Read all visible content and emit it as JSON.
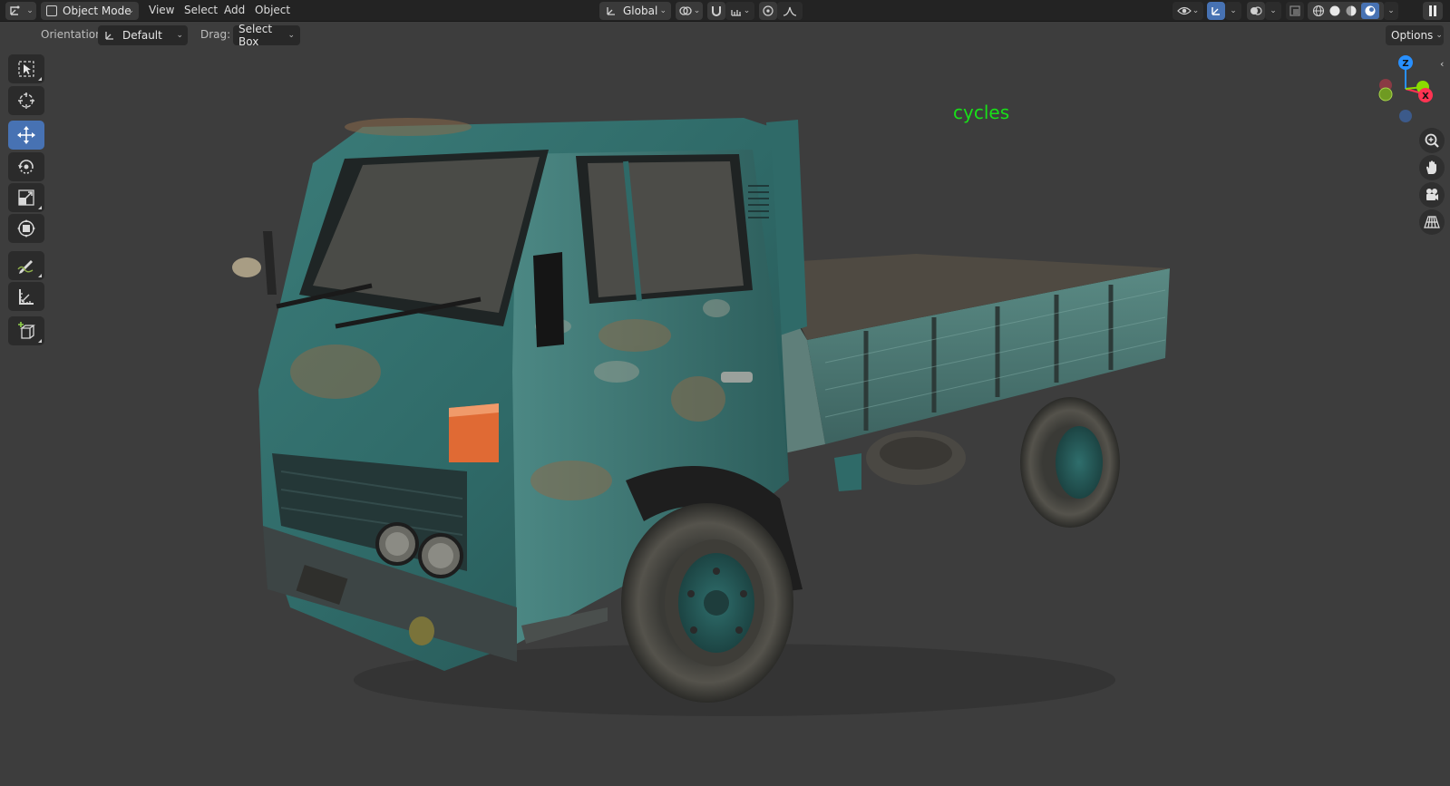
{
  "header": {
    "editor_type_icon": "3d-viewport-icon",
    "mode": "Object Mode",
    "menus": [
      "View",
      "Select",
      "Add",
      "Object"
    ],
    "transform_orientation": "Global",
    "icons": {
      "pivot": "pivot-icon",
      "snap": "magnet-icon",
      "snap_target": "snap-increment-icon",
      "proportional": "proportional-edit-icon",
      "falloff": "falloff-curve-icon",
      "visibility": "eye-icon",
      "gizmo": "gizmo-icon",
      "overlay": "overlay-icon",
      "xray": "xray-icon",
      "shading_wire": "wireframe-icon",
      "shading_solid": "solid-icon",
      "shading_material": "material-icon",
      "shading_rendered": "rendered-icon"
    }
  },
  "tool_settings": {
    "orientation_label": "Orientation:",
    "orientation_value": "Default",
    "drag_label": "Drag:",
    "drag_value": "Select Box",
    "options_label": "Options"
  },
  "tools": [
    {
      "name": "select-box-tool",
      "active": false
    },
    {
      "name": "cursor-tool",
      "active": false
    },
    {
      "name": "move-tool",
      "active": true
    },
    {
      "name": "rotate-tool",
      "active": false
    },
    {
      "name": "scale-tool",
      "active": false
    },
    {
      "name": "transform-tool",
      "active": false
    },
    {
      "name": "annotate-tool",
      "active": false
    },
    {
      "name": "measure-tool",
      "active": false
    },
    {
      "name": "add-cube-tool",
      "active": false
    }
  ],
  "viewport": {
    "render_engine_text": "cycles",
    "gizmo_axes": {
      "z": "Z",
      "x": "X"
    },
    "nav_buttons": [
      "zoom-icon",
      "hand-pan-icon",
      "camera-icon",
      "grid-perspective-icon"
    ]
  },
  "colors": {
    "accent": "#4772b3",
    "axis_x": "#ff3352",
    "axis_y": "#8bdc00",
    "axis_z": "#2890ff",
    "cycles_text": "#18e018",
    "truck_paint": "#2f6e6c"
  }
}
